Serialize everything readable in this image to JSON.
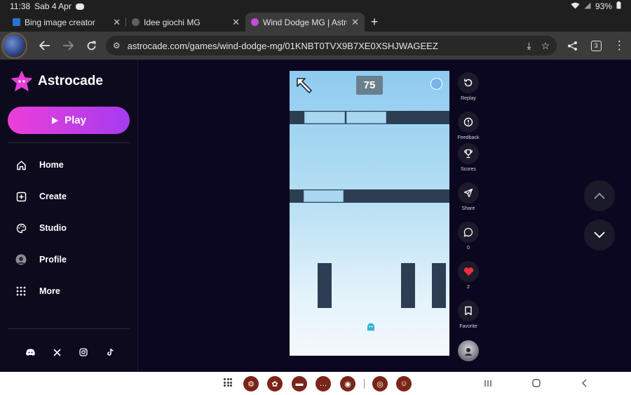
{
  "status": {
    "time": "11:38",
    "date": "Sab 4 Apr",
    "battery": "93%"
  },
  "tabs": [
    {
      "label": "Bing image creator",
      "favicon_color": "#2b73d6",
      "active": false
    },
    {
      "label": "Idee giochi MG",
      "favicon_color": "#5f5f5f",
      "active": false
    },
    {
      "label": "Wind Dodge MG | Astroca",
      "favicon_color": "#c24dd6",
      "active": true
    }
  ],
  "toolbar": {
    "url": "astrocade.com/games/wind-dodge-mg/01KNBT0TVX9B7XE0XSHJWAGEEZ",
    "tab_count": "3"
  },
  "sidebar": {
    "brand": "Astrocade",
    "play_label": "Play",
    "nav": [
      {
        "label": "Home",
        "icon": "home-icon"
      },
      {
        "label": "Create",
        "icon": "plus-square-icon"
      },
      {
        "label": "Studio",
        "icon": "palette-icon"
      },
      {
        "label": "Profile",
        "icon": "avatar-icon"
      },
      {
        "label": "More",
        "icon": "grid-dots-icon"
      }
    ],
    "social": [
      "discord-icon",
      "x-icon",
      "instagram-icon",
      "tiktok-icon"
    ]
  },
  "game": {
    "score": "75"
  },
  "actions": [
    {
      "label": "Replay",
      "icon": "replay-icon"
    },
    {
      "label": "Feedback",
      "icon": "feedback-icon"
    },
    {
      "label": "Scores",
      "icon": "trophy-icon"
    },
    {
      "label": "Share",
      "icon": "share-icon"
    },
    {
      "label": "0",
      "icon": "comment-icon"
    },
    {
      "label": "2",
      "icon": "heart-icon"
    },
    {
      "label": "Favorite",
      "icon": "bookmark-icon"
    }
  ],
  "colors": {
    "accent_start": "#ec3fd8",
    "accent_end": "#a53bf0",
    "like": "#e8323b",
    "dock_app": "#7a2518"
  }
}
